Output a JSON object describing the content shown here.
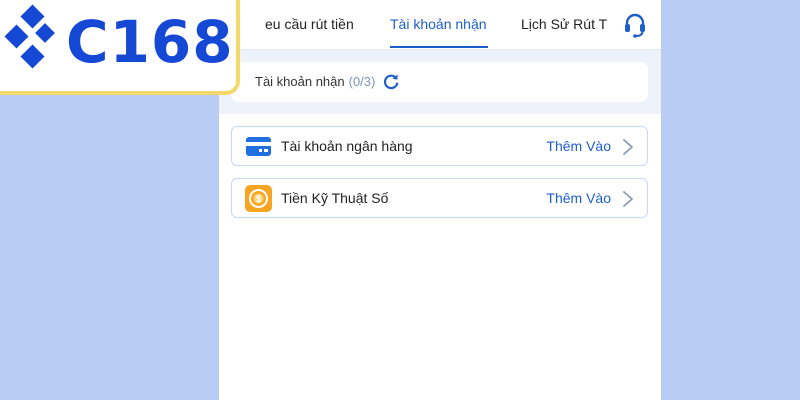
{
  "tabs": [
    {
      "label": "eu cầu rút tiền",
      "active": false
    },
    {
      "label": "Tài khoản nhận",
      "active": true
    },
    {
      "label": "Lịch Sử Rút T",
      "active": false
    }
  ],
  "summary": {
    "label": "Tài khoản nhận",
    "count": "(0/3)"
  },
  "accounts": [
    {
      "label": "Tài khoản ngân hàng",
      "action": "Thêm Vào",
      "icon": "bank-card-icon"
    },
    {
      "label": "Tiền Kỹ Thuật Số",
      "action": "Thêm Vào",
      "icon": "crypto-coin-icon"
    }
  ],
  "logo": {
    "text": "C168"
  },
  "colors": {
    "accent": "#1f5fcc",
    "background": "#b9cdf4",
    "logo_blue": "#1648d6",
    "logo_border": "#f3d96b",
    "coin_orange": "#f6a623"
  }
}
